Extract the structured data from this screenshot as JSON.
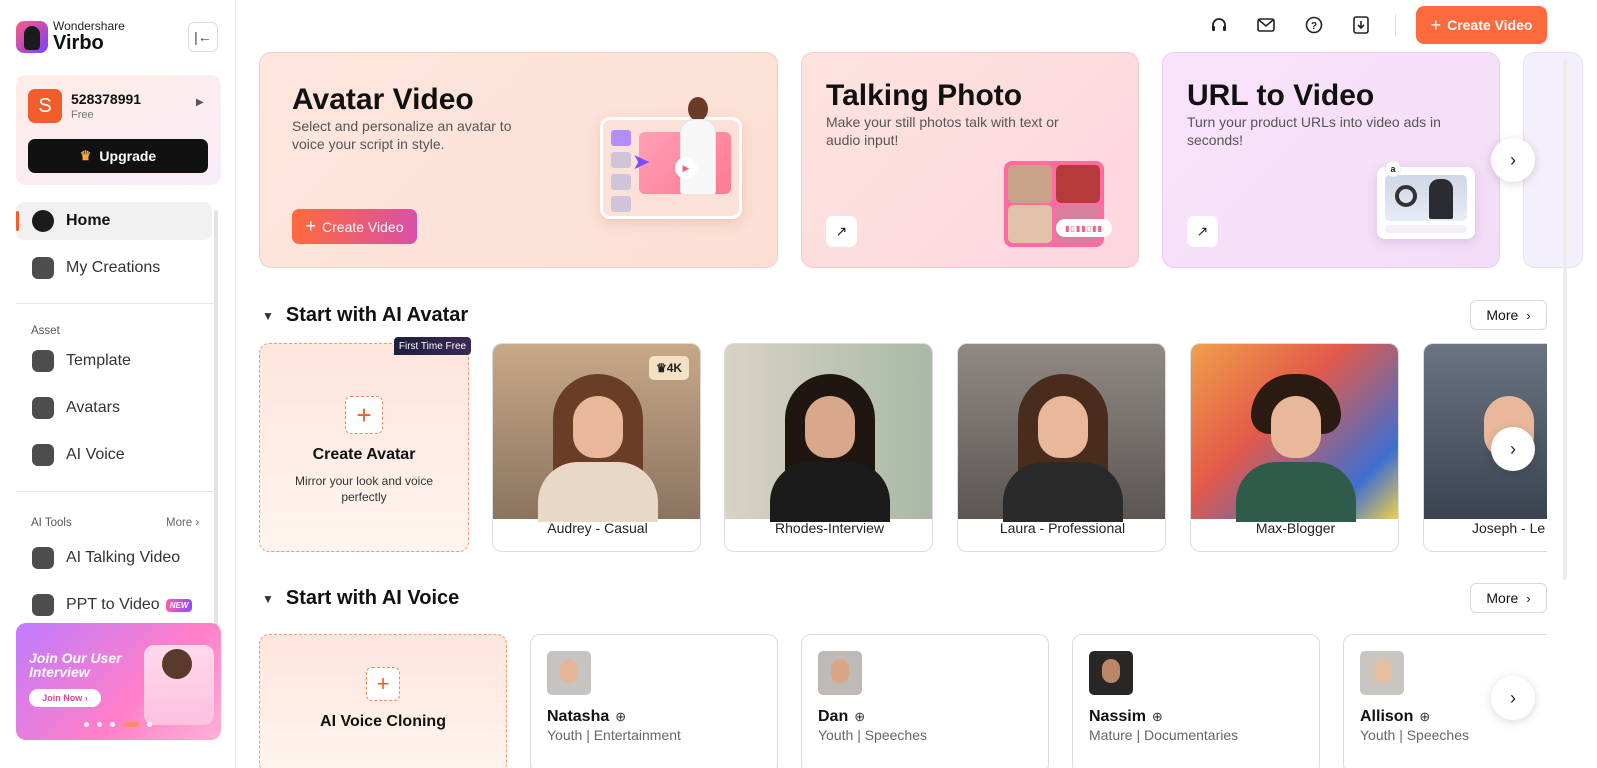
{
  "sidebar": {
    "brand": "Wondershare",
    "product": "Virbo",
    "collapse_icon": "collapse-sidebar-icon",
    "user": {
      "avatar_letter": "S",
      "id": "528378991",
      "plan": "Free"
    },
    "upgrade_label": "Upgrade",
    "nav_main": [
      {
        "label": "Home",
        "icon": "home-icon",
        "active": true
      },
      {
        "label": "My Creations",
        "icon": "folder-icon",
        "active": false
      }
    ],
    "asset_section": "Asset",
    "nav_asset": [
      {
        "label": "Template",
        "icon": "template-icon"
      },
      {
        "label": "Avatars",
        "icon": "avatar-icon"
      },
      {
        "label": "AI Voice",
        "icon": "voice-icon"
      }
    ],
    "tools_section": "AI Tools",
    "tools_more": "More",
    "nav_tools": [
      {
        "label": "AI Talking Video",
        "icon": "talking-video-icon"
      },
      {
        "label": "PPT to Video",
        "icon": "ppt-icon",
        "badge": "NEW"
      }
    ],
    "promo": {
      "title": "Join Our User Interview",
      "button": "Join Now"
    }
  },
  "topbar": {
    "icons": [
      "headset-icon",
      "mail-icon",
      "help-icon",
      "download-icon"
    ],
    "create_label": "Create Video"
  },
  "features": [
    {
      "title": "Avatar Video",
      "desc": "Select and personalize an avatar to voice your script in style.",
      "button": "Create Video"
    },
    {
      "title": "Talking Photo",
      "desc": "Make your still photos talk with text or audio input!"
    },
    {
      "title": "URL to Video",
      "desc": "Turn your product URLs into video ads in seconds!"
    }
  ],
  "avatar_section": {
    "title": "Start with AI Avatar",
    "more": "More",
    "create": {
      "badge": "First Time Free",
      "title": "Create Avatar",
      "sub": "Mirror your look and voice perfectly"
    },
    "avatars": [
      {
        "name": "Audrey - Casual",
        "badge": "4K"
      },
      {
        "name": "Rhodes-Interview"
      },
      {
        "name": "Laura - Professional"
      },
      {
        "name": "Max-Blogger"
      },
      {
        "name": "Joseph - Le"
      }
    ]
  },
  "voice_section": {
    "title": "Start with AI Voice",
    "more": "More",
    "create": {
      "title": "AI Voice Cloning"
    },
    "voices": [
      {
        "name": "Natasha",
        "tags": "Youth | Entertainment"
      },
      {
        "name": "Dan",
        "tags": "Youth | Speeches"
      },
      {
        "name": "Nassim",
        "tags": "Mature | Documentaries"
      },
      {
        "name": "Allison",
        "tags": "Youth | Speeches"
      }
    ]
  },
  "colors": {
    "accent": "#ff6a3d",
    "active_bar": "#f25d2c"
  }
}
